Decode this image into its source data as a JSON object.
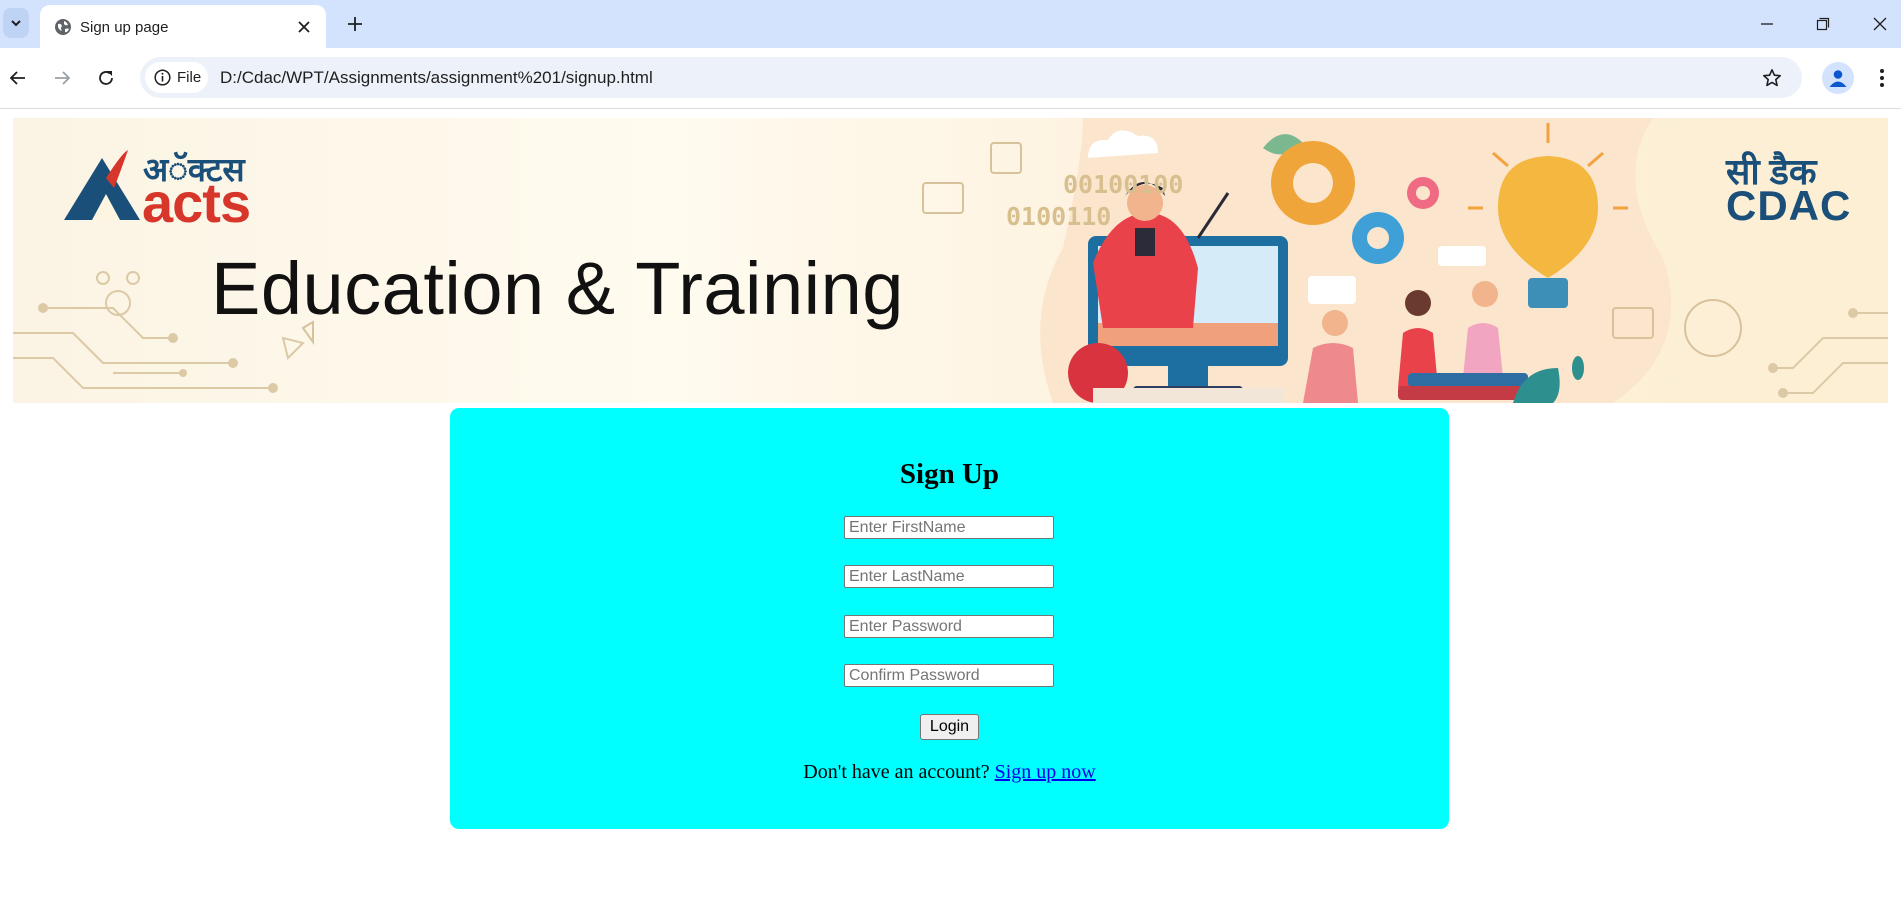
{
  "browser": {
    "tab": {
      "title": "Sign up page"
    },
    "address_bar": {
      "security_chip": "File",
      "url": "D:/Cdac/WPT/Assignments/assignment%201/signup.html"
    }
  },
  "banner": {
    "title": "Education & Training",
    "left_logo": {
      "hindi": "अॅक्टस",
      "latin": "acts"
    },
    "right_logo": {
      "hindi": "सी डैक",
      "latin": "CDAC"
    },
    "binary_text": [
      "00100100",
      "0100110"
    ]
  },
  "signup": {
    "heading": "Sign Up",
    "first_name": {
      "placeholder": "Enter FirstName",
      "value": ""
    },
    "last_name": {
      "placeholder": "Enter LastName",
      "value": ""
    },
    "password": {
      "placeholder": "Enter Password",
      "value": ""
    },
    "confirm_password": {
      "placeholder": "Confirm Password",
      "value": ""
    },
    "submit_label": "Login",
    "account_prompt": "Don't have an account?",
    "signup_link": "Sign up now"
  },
  "colors": {
    "card_background": "#00ffff",
    "tabstrip": "#d3e3fd",
    "link": "#0000ee"
  },
  "icons": [
    "chevron-down-icon",
    "globe-icon",
    "close-icon",
    "plus-icon",
    "minimize-icon",
    "restore-icon",
    "window-close-icon",
    "back-arrow-icon",
    "forward-arrow-icon",
    "reload-icon",
    "info-icon",
    "star-icon",
    "profile-icon",
    "kebab-menu-icon"
  ]
}
